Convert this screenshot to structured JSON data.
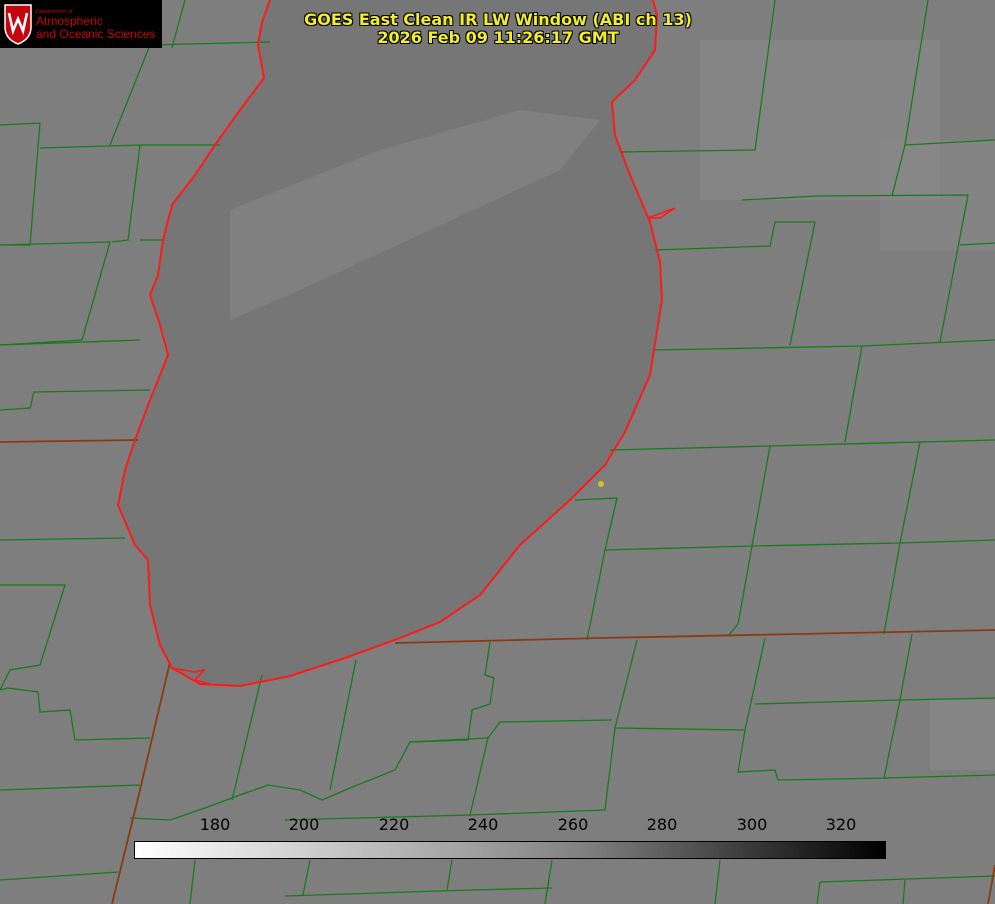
{
  "header": {
    "title_line1": "GOES East Clean IR LW Window (ABI ch 13)",
    "title_line2": "2026 Feb 09 11:26:17 GMT"
  },
  "logo": {
    "department_line": "Department of",
    "name_line1": "Atmospheric",
    "name_line2": "and Oceanic Sciences"
  },
  "colorbar": {
    "ticks": [
      "180",
      "200",
      "220",
      "240",
      "260",
      "280",
      "300",
      "320"
    ],
    "gradient": [
      "#ffffff",
      "#808080",
      "#000000"
    ]
  },
  "colors": {
    "title": "#f2ee2a",
    "county_lines": "#1a7a1a",
    "state_lines": "#8b3a12",
    "coastline": "#ff1a1a",
    "marker": "#d9c21a",
    "lake": "#757575",
    "land": "#7e7e7e"
  },
  "icons": {
    "logo": "uw-crest-icon",
    "marker": "city-dot-icon"
  }
}
